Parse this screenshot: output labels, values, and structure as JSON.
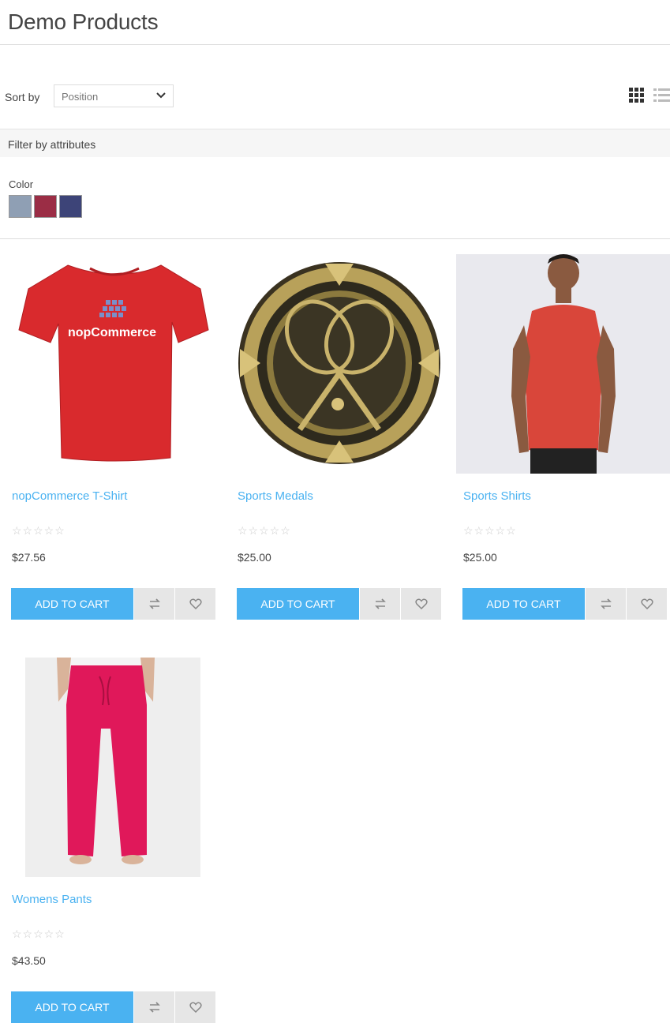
{
  "page": {
    "title": "Demo Products"
  },
  "sort": {
    "label": "Sort by",
    "selected": "Position"
  },
  "view_modes": [
    "grid-icon",
    "list-icon"
  ],
  "filter": {
    "title": "Filter by attributes",
    "attribute": "Color",
    "swatches": [
      "#8f9fb4",
      "#9b2d45",
      "#3d4478"
    ]
  },
  "theme": {
    "accent": "#4ab2f1",
    "button_gray": "#e6e6e6"
  },
  "products": [
    {
      "name": "nopCommerce T-Shirt",
      "price": "$27.56",
      "rating_stars": 0,
      "cart_label": "ADD TO CART"
    },
    {
      "name": "Sports Medals",
      "price": "$25.00",
      "rating_stars": 0,
      "cart_label": "ADD TO CART"
    },
    {
      "name": "Sports Shirts",
      "price": "$25.00",
      "rating_stars": 0,
      "cart_label": "ADD TO CART"
    },
    {
      "name": "Womens Pants",
      "price": "$43.50",
      "rating_stars": 0,
      "cart_label": "ADD TO CART"
    }
  ]
}
